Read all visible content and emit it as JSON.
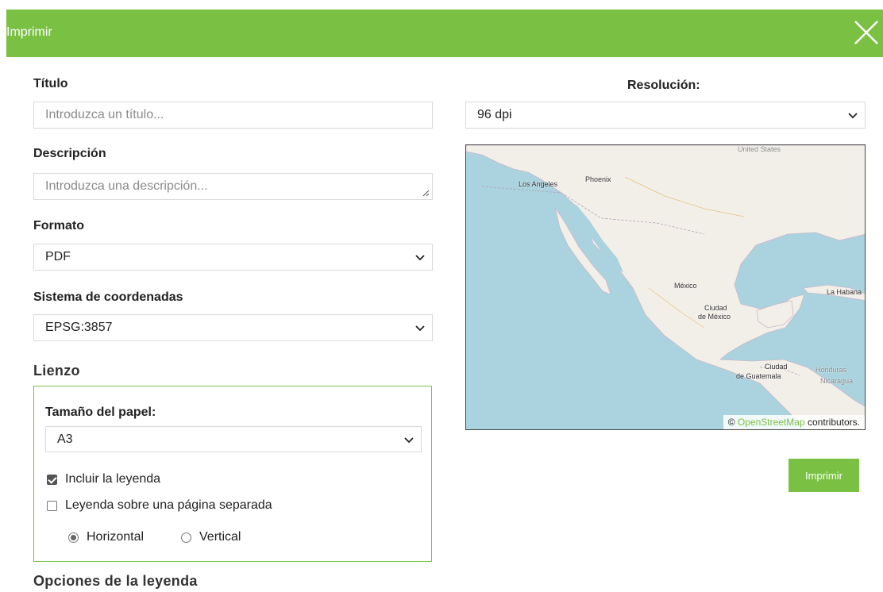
{
  "dialog": {
    "title": "Imprimir"
  },
  "form": {
    "title_label": "Título",
    "title_placeholder": "Introduzca un título...",
    "description_label": "Descripción",
    "description_placeholder": "Introduzca una descripción...",
    "format_label": "Formato",
    "format_value": "PDF",
    "crs_label": "Sistema de coordenadas",
    "crs_value": "EPSG:3857",
    "canvas_section": "Lienzo",
    "paper_size_label": "Tamaño del papel:",
    "paper_size_value": "A3",
    "include_legend_label": "Incluir la leyenda",
    "include_legend_checked": true,
    "legend_separate_label": "Leyenda sobre una página separada",
    "legend_separate_checked": false,
    "orientation_horizontal_label": "Horizontal",
    "orientation_vertical_label": "Vertical",
    "orientation_selected": "Horizontal",
    "legend_options_section": "Opciones de la leyenda"
  },
  "preview": {
    "resolution_label": "Resolución:",
    "resolution_value": "96 dpi",
    "attribution_prefix": "©",
    "attribution_link": "OpenStreetMap",
    "attribution_suffix": "contributors.",
    "places": {
      "united_states": "United States",
      "los_angeles": "Los Angeles",
      "phoenix": "Phoenix",
      "mexico": "México",
      "ciudad_de_mexico_1": "Ciudad",
      "ciudad_de_mexico_2": "de México",
      "la_habana": "La Habana",
      "ciudad_de_guatemala_1": "Ciudad",
      "ciudad_de_guatemala_2": "de Guatemala",
      "honduras": "Honduras",
      "nicaragua": "Nicaragua"
    }
  },
  "actions": {
    "print_label": "Imprimir"
  },
  "colors": {
    "accent": "#7ac143",
    "water": "#aad3df",
    "land": "#f2efe9"
  }
}
